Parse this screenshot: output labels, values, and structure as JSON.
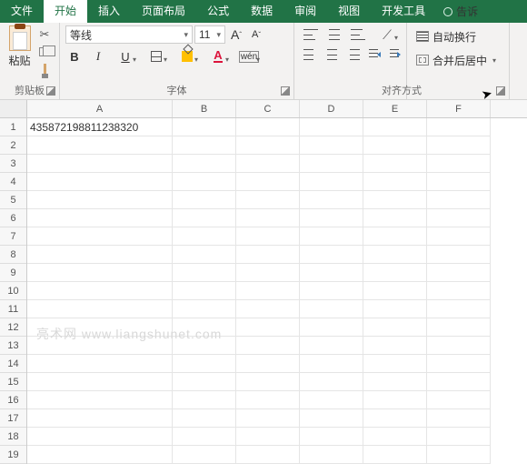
{
  "tabs": {
    "file": "文件",
    "home": "开始",
    "insert": "插入",
    "layout": "页面布局",
    "formula": "公式",
    "data": "数据",
    "review": "审阅",
    "view": "视图",
    "dev": "开发工具",
    "tell": "告诉"
  },
  "ribbon": {
    "clipboard": {
      "paste": "粘贴",
      "label": "剪贴板"
    },
    "font": {
      "name": "等线",
      "size": "11",
      "inc": "A",
      "dec": "A",
      "bold": "B",
      "italic": "I",
      "underline": "U",
      "wen": "wén",
      "color": "A",
      "label": "字体"
    },
    "align": {
      "wrap": "自动换行",
      "merge": "合并后居中",
      "label": "对齐方式"
    }
  },
  "columns": [
    "A",
    "B",
    "C",
    "D",
    "E",
    "F"
  ],
  "rows": [
    "1",
    "2",
    "3",
    "4",
    "5",
    "6",
    "7",
    "8",
    "9",
    "10",
    "11",
    "12",
    "13",
    "14",
    "15",
    "16",
    "17",
    "18",
    "19"
  ],
  "cells": {
    "A1": "435872198811238320"
  },
  "watermark": "亮术网  www.liangshunet.com",
  "chart_data": null
}
